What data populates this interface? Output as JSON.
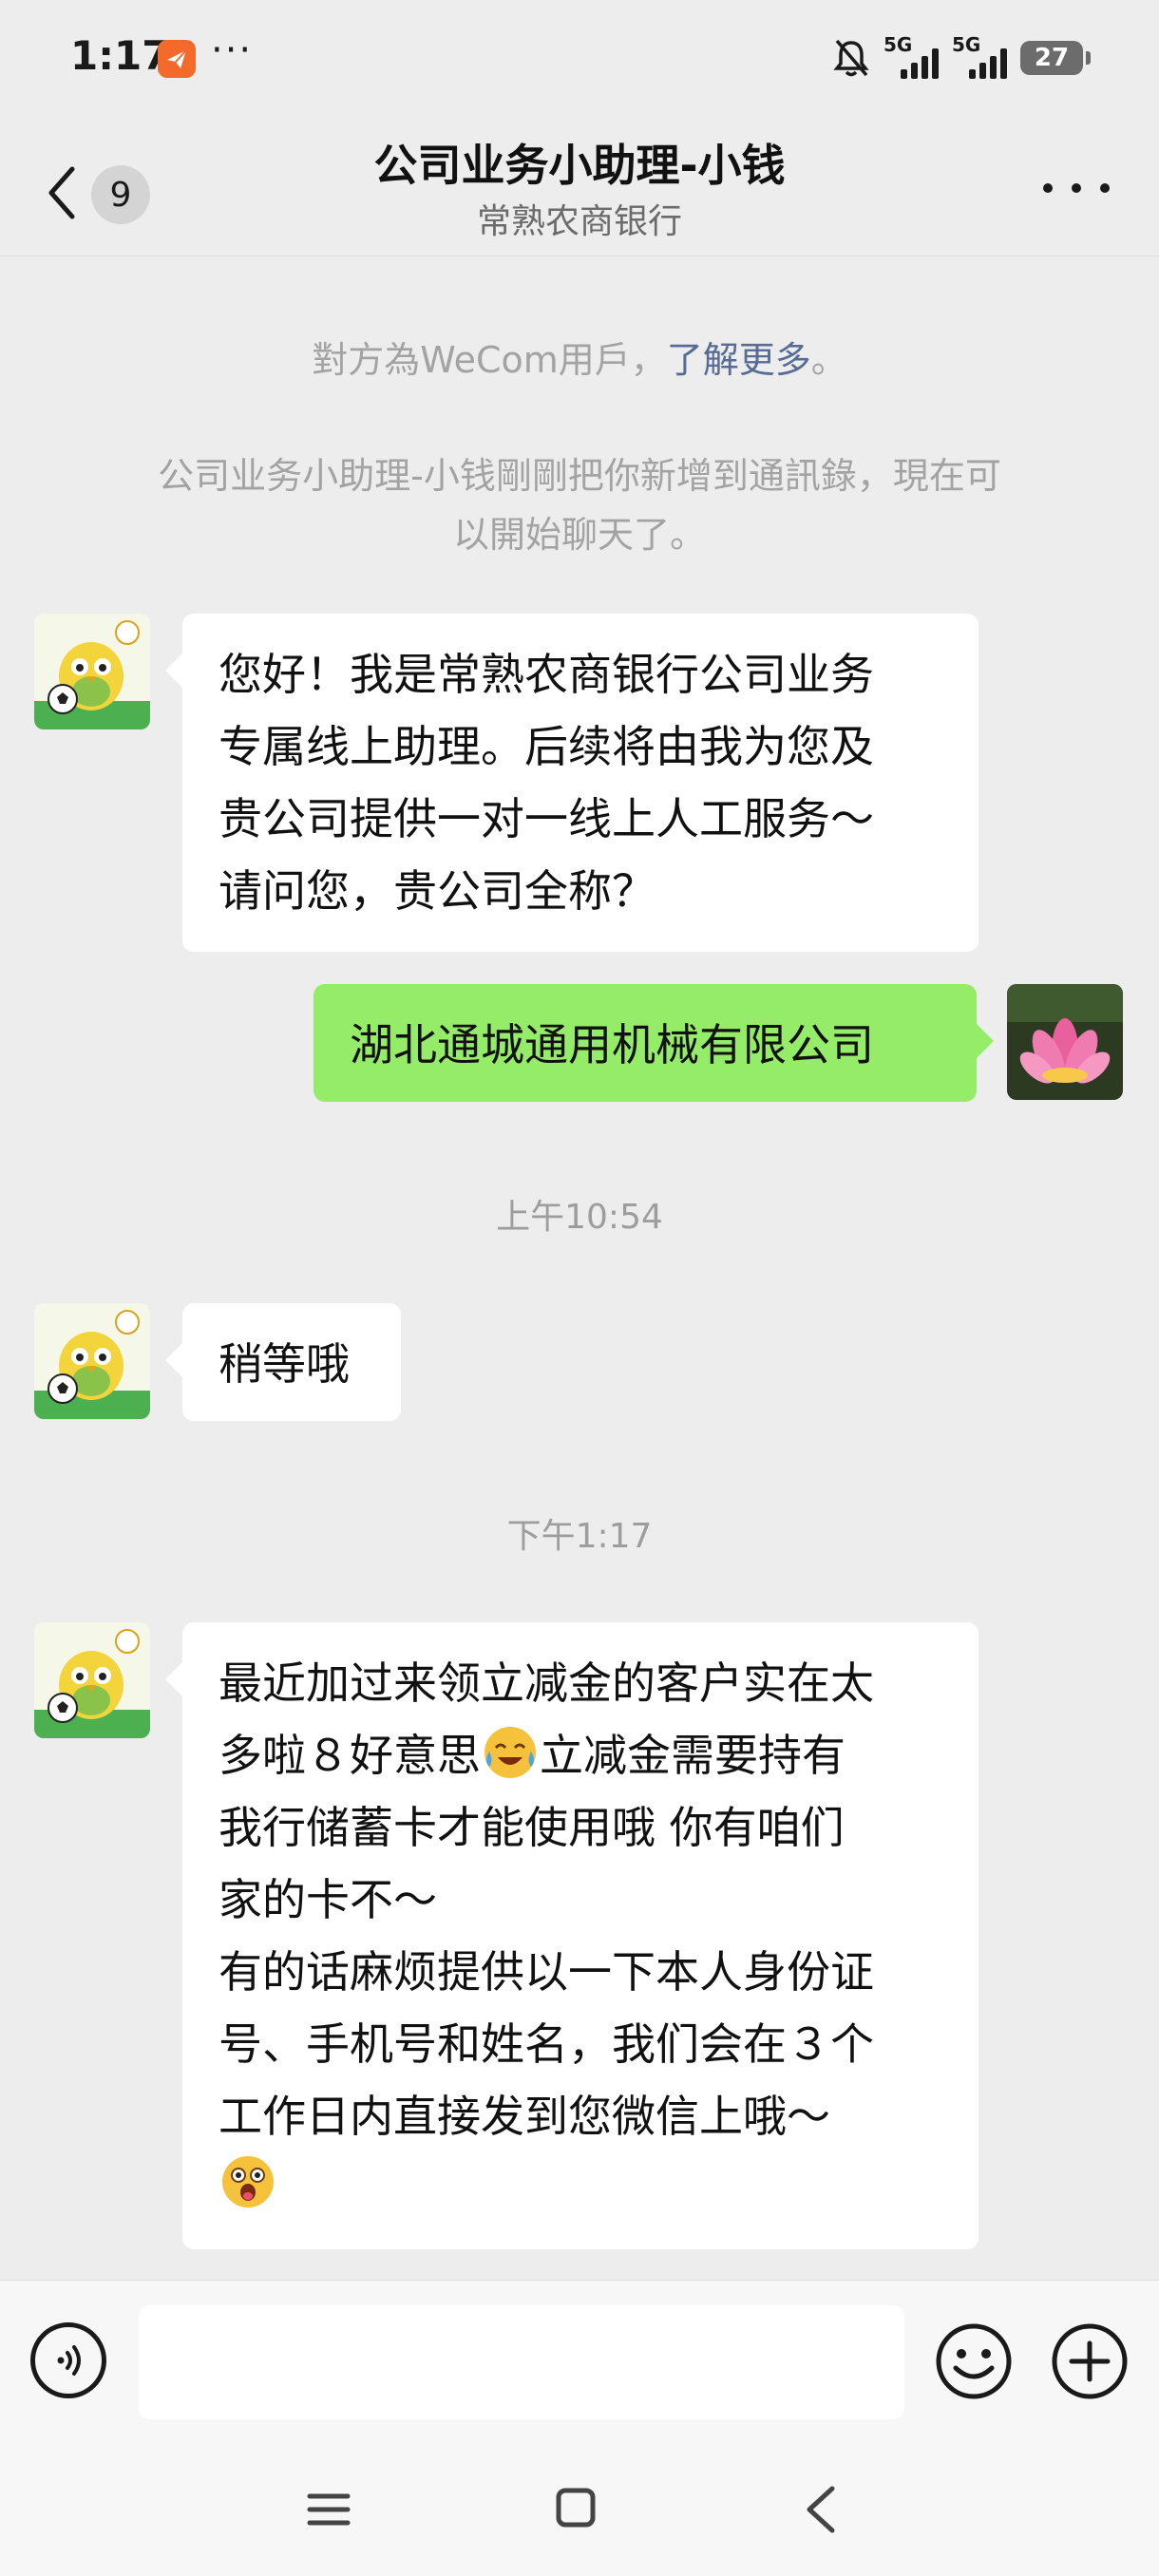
{
  "status_bar": {
    "time": "1:17",
    "more": "···",
    "network_1": "5G",
    "network_2": "5G",
    "battery": "27"
  },
  "header": {
    "unread_count": "9",
    "title": "公司业务小助理-小钱",
    "subtitle": "常熟农商银行"
  },
  "system_notes": {
    "wecom_prefix": "對方為WeCom用戶，",
    "wecom_link": "了解更多",
    "wecom_suffix": "。",
    "added_line1": "公司业务小助理-小钱剛剛把你新增到通訊錄，現在可",
    "added_line2": "以開始聊天了。"
  },
  "messages": [
    {
      "side": "left",
      "lines": [
        "您好！我是常熟农商银行公司业务",
        "专属线上助理。后续将由我为您及",
        "贵公司提供一对一线上人工服务～",
        "请问您，贵公司全称？"
      ]
    },
    {
      "side": "right",
      "lines": [
        "湖北通城通用机械有限公司"
      ]
    },
    {
      "timestamp": "上午10:54"
    },
    {
      "side": "left",
      "lines": [
        "稍等哦"
      ]
    },
    {
      "timestamp": "下午1:17"
    },
    {
      "side": "left",
      "line1": "最近加过来领立减金的客户实在太",
      "line2_before": "多啦８好意思",
      "line2_emoji": "laughing-crying-emoji",
      "line2_after": "立减金需要持有",
      "line3": "我行储蓄卡才能使用哦 你有咱们",
      "line4": "家的卡不～",
      "line5": "有的话麻烦提供以一下本人身份证",
      "line6": "号、手机号和姓名，我们会在３个",
      "line7": "工作日内直接发到您微信上哦～",
      "line8_emoji": "surprised-emoji"
    }
  ],
  "colors": {
    "background": "#ededed",
    "bubble_left": "#ffffff",
    "bubble_right": "#95ec69",
    "link": "#576b95",
    "system_text": "#a3a3a3"
  },
  "icons": {
    "back": "chevron-left-icon",
    "more": "more-dots-icon",
    "voice": "voice-icon",
    "emoji": "emoji-face-icon",
    "plus": "plus-circle-icon",
    "nav_menu": "menu-icon",
    "nav_home": "home-square-icon",
    "nav_back": "nav-back-icon"
  }
}
